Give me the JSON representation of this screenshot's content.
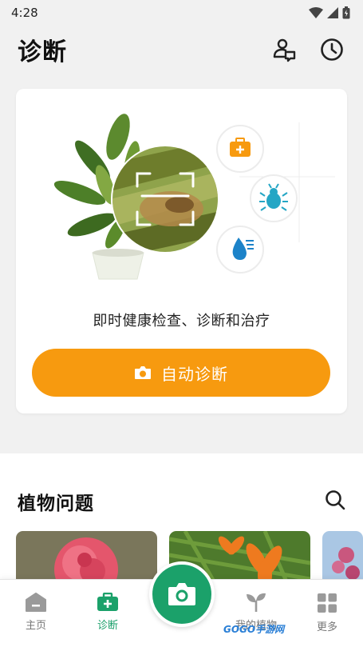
{
  "status_bar": {
    "time": "4:28"
  },
  "header": {
    "title": "诊断",
    "icons": [
      "expert-chat-icon",
      "history-clock-icon"
    ]
  },
  "diagnosis_card": {
    "tagline": "即时健康检查、诊断和治疗",
    "auto_button_label": "自动诊断",
    "feature_icons": [
      "first-aid-kit-icon",
      "bug-icon",
      "water-drop-icon"
    ],
    "colors": {
      "accent": "#f79a0f"
    }
  },
  "plant_problems": {
    "title": "植物问题"
  },
  "bottom_nav": {
    "items": [
      {
        "label": "主页",
        "icon": "home-icon"
      },
      {
        "label": "诊断",
        "icon": "diagnosis-kit-icon",
        "active": true
      },
      {
        "label": "我的植物",
        "icon": "sprout-icon"
      },
      {
        "label": "更多",
        "icon": "grid-icon"
      }
    ],
    "camera_icon": "camera-icon",
    "colors": {
      "active": "#1ba16a"
    }
  },
  "watermark": {
    "text": "GOGO手游网"
  }
}
